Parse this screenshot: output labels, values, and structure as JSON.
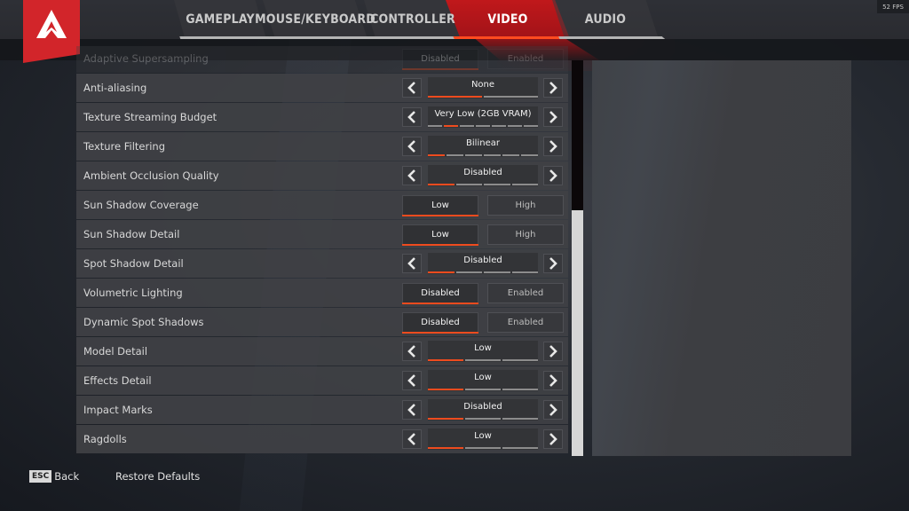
{
  "header": {
    "tabs": [
      {
        "label": "GAMEPLAY",
        "active": false
      },
      {
        "label": "MOUSE/KEYBOARD",
        "active": false
      },
      {
        "label": "CONTROLLER",
        "active": false
      },
      {
        "label": "VIDEO",
        "active": true
      },
      {
        "label": "AUDIO",
        "active": false
      }
    ],
    "fps": "52 FPS",
    "logo_icon": "apex-logo-icon"
  },
  "colors": {
    "accent": "#ee4b1e",
    "brand_red": "#d2252a",
    "row_bg": "#404145",
    "scroll_thumb": "#d6d6d6"
  },
  "settings": [
    {
      "label": "Adaptive Supersampling",
      "type": "toggle",
      "options": [
        "Disabled",
        "Enabled"
      ],
      "selected": 0,
      "faded": true
    },
    {
      "label": "Anti-aliasing",
      "type": "cycler",
      "value": "None",
      "steps": 2,
      "index": 0
    },
    {
      "label": "Texture Streaming Budget",
      "type": "cycler",
      "value": "Very Low (2GB VRAM)",
      "steps": 7,
      "index": 1
    },
    {
      "label": "Texture Filtering",
      "type": "cycler",
      "value": "Bilinear",
      "steps": 6,
      "index": 0
    },
    {
      "label": "Ambient Occlusion Quality",
      "type": "cycler",
      "value": "Disabled",
      "steps": 4,
      "index": 0
    },
    {
      "label": "Sun Shadow Coverage",
      "type": "toggle",
      "options": [
        "Low",
        "High"
      ],
      "selected": 0
    },
    {
      "label": "Sun Shadow Detail",
      "type": "toggle",
      "options": [
        "Low",
        "High"
      ],
      "selected": 0
    },
    {
      "label": "Spot Shadow Detail",
      "type": "cycler",
      "value": "Disabled",
      "steps": 4,
      "index": 0
    },
    {
      "label": "Volumetric Lighting",
      "type": "toggle",
      "options": [
        "Disabled",
        "Enabled"
      ],
      "selected": 0
    },
    {
      "label": "Dynamic Spot Shadows",
      "type": "toggle",
      "options": [
        "Disabled",
        "Enabled"
      ],
      "selected": 0
    },
    {
      "label": "Model Detail",
      "type": "cycler",
      "value": "Low",
      "steps": 3,
      "index": 0
    },
    {
      "label": "Effects Detail",
      "type": "cycler",
      "value": "Low",
      "steps": 3,
      "index": 0
    },
    {
      "label": "Impact Marks",
      "type": "cycler",
      "value": "Disabled",
      "steps": 3,
      "index": 0
    },
    {
      "label": "Ragdolls",
      "type": "cycler",
      "value": "Low",
      "steps": 3,
      "index": 0
    }
  ],
  "scrollbar": {
    "position_fraction": 1.0,
    "visible_fraction": 0.62
  },
  "footer": {
    "esc_key": "ESC",
    "back_label": "Back",
    "restore_label": "Restore Defaults"
  }
}
